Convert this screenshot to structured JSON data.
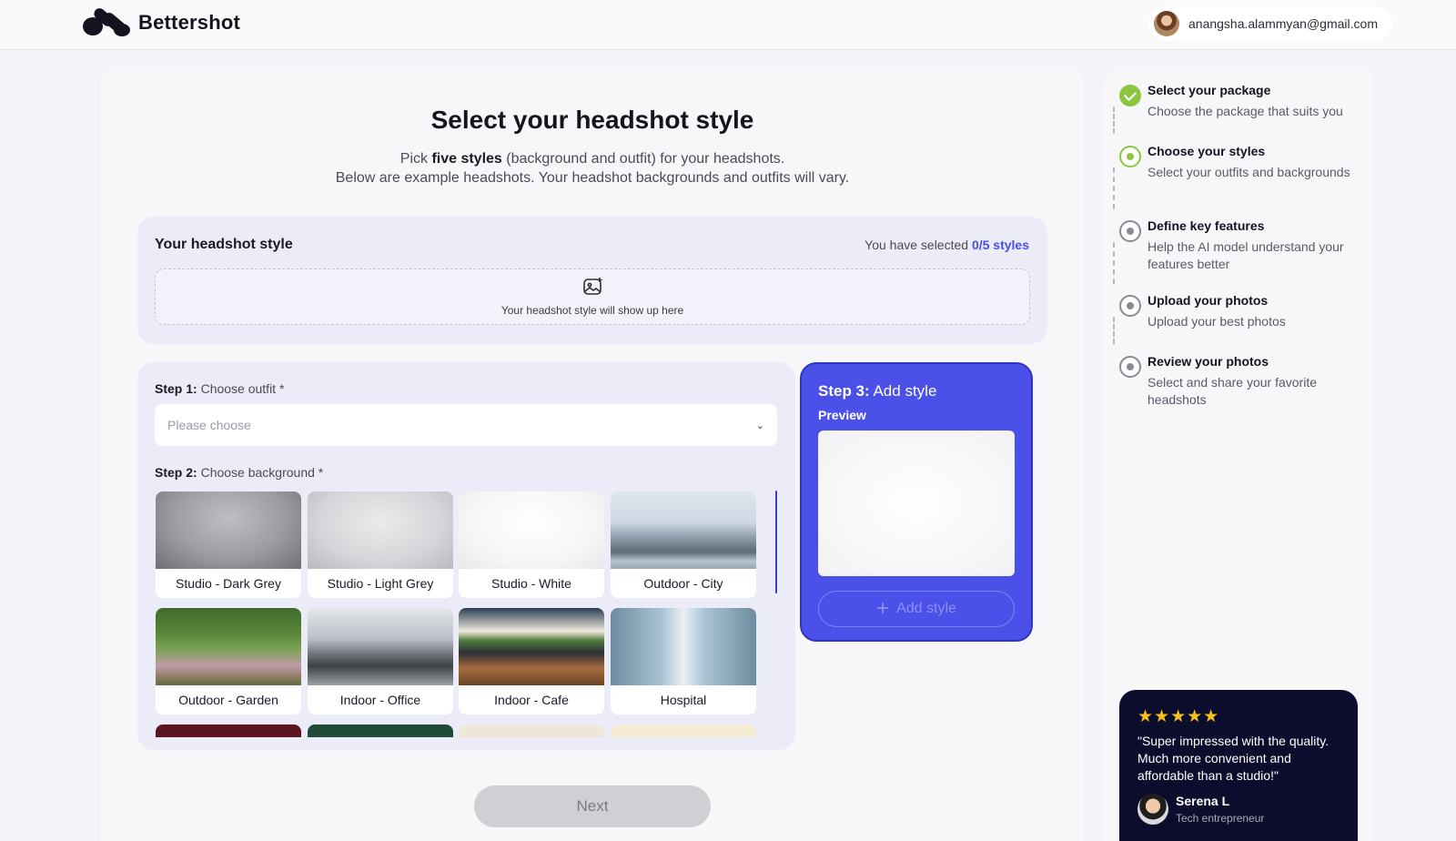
{
  "header": {
    "brand": "Bettershot",
    "user_email": "anangsha.alammyan@gmail.com"
  },
  "main": {
    "title": "Select your headshot style",
    "subtitle_pre": "Pick ",
    "subtitle_bold": "five styles",
    "subtitle_post": " (background and outfit) for your headshots.",
    "subtitle_line2": "Below are example headshots. Your headshot backgrounds and outfits will vary.",
    "style_box": {
      "title": "Your headshot style",
      "selected_prefix": "You have selected ",
      "selected_count": "0/5 styles",
      "placeholder": "Your headshot style will show up here",
      "icon": "image-plus-icon"
    },
    "step1": {
      "label_bold": "Step 1:",
      "label": " Choose outfit *",
      "placeholder": "Please choose"
    },
    "step2": {
      "label_bold": "Step 2:",
      "label": " Choose background *",
      "backgrounds": [
        {
          "label": "Studio - Dark Grey"
        },
        {
          "label": "Studio - Light Grey"
        },
        {
          "label": "Studio - White"
        },
        {
          "label": "Outdoor - City"
        },
        {
          "label": "Outdoor - Garden"
        },
        {
          "label": "Indoor - Office"
        },
        {
          "label": "Indoor - Cafe"
        },
        {
          "label": "Hospital"
        }
      ]
    },
    "step3": {
      "label_bold": "Step 3:",
      "label": " Add style",
      "preview": "Preview",
      "add_button": "Add style"
    },
    "next_button": "Next"
  },
  "sidebar": {
    "steps": [
      {
        "title": "Select your package",
        "desc": "Choose the package that suits you",
        "state": "done"
      },
      {
        "title": "Choose your styles",
        "desc": "Select your outfits and backgrounds",
        "state": "current"
      },
      {
        "title": "Define key features",
        "desc": "Help the AI model understand your features better",
        "state": "todo"
      },
      {
        "title": "Upload your photos",
        "desc": "Upload your best photos",
        "state": "todo"
      },
      {
        "title": "Review your photos",
        "desc": "Select and share your favorite headshots",
        "state": "todo"
      }
    ],
    "review": {
      "rating": 5,
      "quote": "\"Super impressed with the quality. Much more convenient and affordable than a studio!\"",
      "name": "Serena L",
      "role": "Tech entrepreneur"
    }
  },
  "colors": {
    "accent": "#4b50e8",
    "success": "#8cc63f",
    "review_bg": "#0c0c2c",
    "star": "#f6c21a"
  }
}
